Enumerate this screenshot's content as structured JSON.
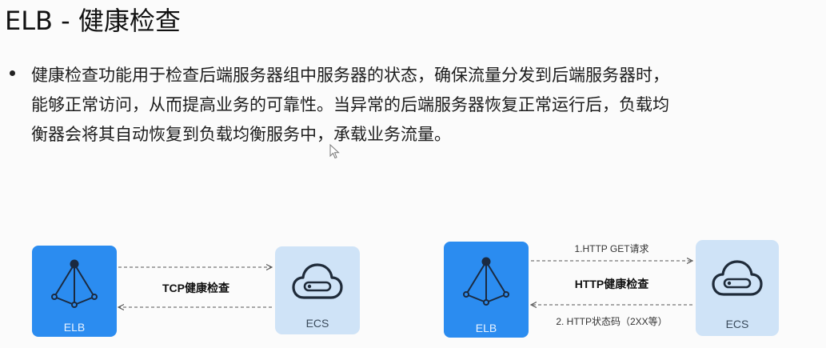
{
  "title": "ELB - 健康检查",
  "bullet": {
    "lines": [
      "健康检查功能用于检查后端服务器组中服务器的状态，确保流量分发到后端服务器时，",
      "能够正常访问，从而提高业务的可靠性。当异常的后端服务器恢复正常运行后，负载均",
      "衡器会将其自动恢复到负载均衡服务中，承载业务流量。"
    ]
  },
  "diagram_left": {
    "elb_label": "ELB",
    "ecs_label": "ECS",
    "check_label": "TCP健康检查"
  },
  "diagram_right": {
    "elb_label": "ELB",
    "ecs_label": "ECS",
    "request_label": "1.HTTP  GET请求",
    "check_label": "HTTP健康检查",
    "response_label": "2. HTTP状态码（2XX等）"
  },
  "colors": {
    "elb_blue": "#2b8cf0",
    "ecs_light": "#cfe3f7",
    "arrow": "#555555"
  }
}
